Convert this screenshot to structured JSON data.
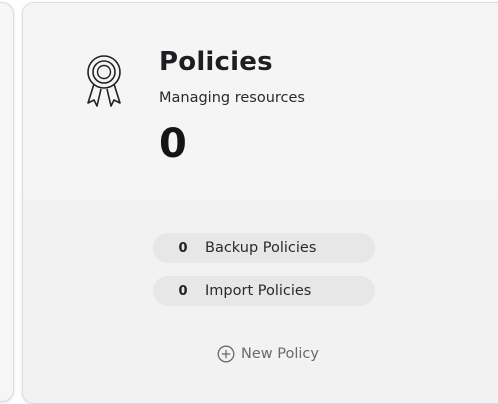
{
  "card": {
    "title": "Policies",
    "subtitle": "Managing resources",
    "count": "0",
    "icon": "award-ribbon-icon"
  },
  "stats": [
    {
      "value": "0",
      "label": "Backup Policies"
    },
    {
      "value": "0",
      "label": "Import Policies"
    }
  ],
  "action": {
    "label": "New Policy",
    "icon": "plus-circle-icon"
  },
  "colors": {
    "card_background": "#f5f5f5",
    "pill_background": "#e7e7e7",
    "text_dark": "#1d1d22",
    "text_muted": "#6a6a6a"
  }
}
